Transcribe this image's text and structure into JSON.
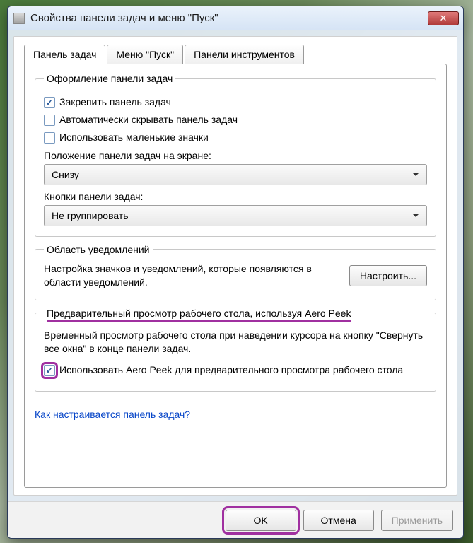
{
  "window": {
    "title": "Свойства панели задач и меню \"Пуск\""
  },
  "tabs": {
    "items": [
      {
        "label": "Панель задач"
      },
      {
        "label": "Меню \"Пуск\""
      },
      {
        "label": "Панели инструментов"
      }
    ],
    "active": 0
  },
  "appearance": {
    "legend": "Оформление панели задач",
    "lock": {
      "label": "Закрепить панель задач",
      "checked": true
    },
    "autohide": {
      "label": "Автоматически скрывать панель задач",
      "checked": false
    },
    "smallicons": {
      "label": "Использовать маленькие значки",
      "checked": false
    },
    "position_label": "Положение панели задач на экране:",
    "position_value": "Снизу",
    "buttons_label": "Кнопки панели задач:",
    "buttons_value": "Не группировать"
  },
  "notifications": {
    "legend": "Область уведомлений",
    "text": "Настройка значков и уведомлений, которые появляются в области уведомлений.",
    "button": "Настроить..."
  },
  "aero": {
    "legend": "Предварительный просмотр рабочего стола, используя Aero Peek",
    "desc": "Временный просмотр рабочего стола при наведении курсора на кнопку \"Свернуть все окна\" в конце панели задач.",
    "checkbox": {
      "label": "Использовать Aero Peek для предварительного просмотра рабочего стола",
      "checked": true
    }
  },
  "link": "Как настраивается панель задач?",
  "footer": {
    "ok": "OK",
    "cancel": "Отмена",
    "apply": "Применить"
  }
}
